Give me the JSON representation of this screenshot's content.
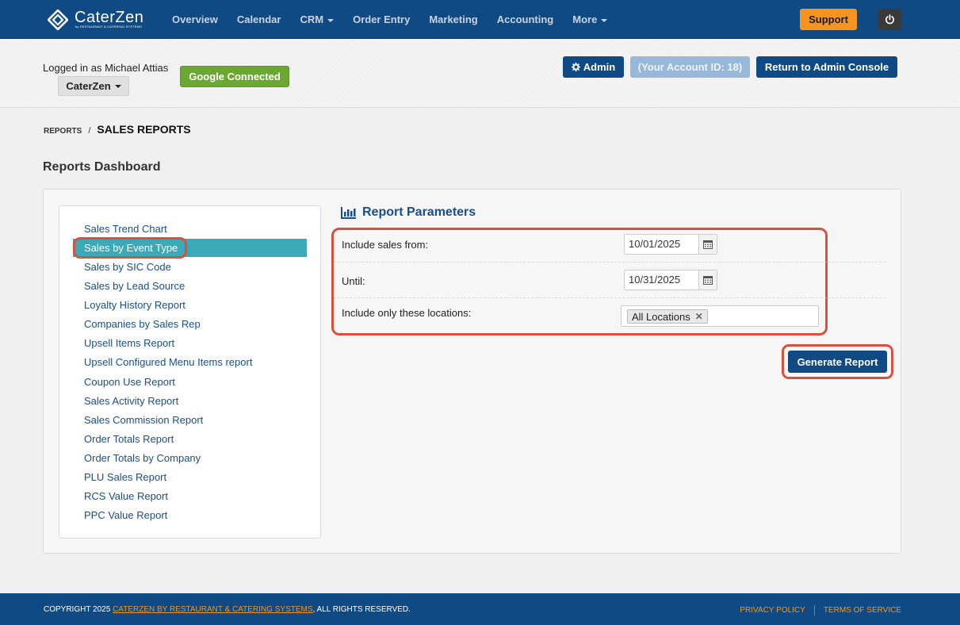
{
  "brand": {
    "name": "CaterZen",
    "tagline": "by RESTAURANT & CATERING SYSTEMS"
  },
  "nav": {
    "items": [
      {
        "label": "Overview",
        "dropdown": false
      },
      {
        "label": "Calendar",
        "dropdown": false
      },
      {
        "label": "CRM",
        "dropdown": true
      },
      {
        "label": "Order Entry",
        "dropdown": false
      },
      {
        "label": "Marketing",
        "dropdown": false
      },
      {
        "label": "Accounting",
        "dropdown": false
      },
      {
        "label": "More",
        "dropdown": true
      }
    ],
    "support_label": "Support",
    "power_icon": "power-icon"
  },
  "account": {
    "logged_in_text": "Logged in as Michael Attias",
    "org_label": "CaterZen",
    "google_label": "Google Connected",
    "admin_label": "Admin",
    "account_id_label": "(Your Account ID: 18)",
    "return_label": "Return to Admin Console"
  },
  "breadcrumb": {
    "parent": "REPORTS",
    "separator": "/",
    "current": "SALES REPORTS"
  },
  "page_title": "Reports Dashboard",
  "reports": [
    "Sales Trend Chart",
    "Sales by Event Type",
    "Sales by SIC Code",
    "Sales by Lead Source",
    "Loyalty History Report",
    "Companies by Sales Rep",
    "Upsell Items Report",
    "Upsell Configured Menu Items report",
    "Coupon Use Report",
    "Sales Activity Report",
    "Sales Commission Report",
    "Order Totals Report",
    "Order Totals by Company",
    "PLU Sales Report",
    "RCS Value Report",
    "PPC Value Report"
  ],
  "active_report_index": 1,
  "params": {
    "title": "Report Parameters",
    "from_label": "Include sales from:",
    "from_value": "10/01/2025",
    "until_label": "Until:",
    "until_value": "10/31/2025",
    "locations_label": "Include only these locations:",
    "location_tag": "All Locations",
    "generate_label": "Generate Report"
  },
  "footer": {
    "copyright_prefix": "COPYRIGHT 2025 ",
    "company_link": "CATERZEN BY RESTAURANT & CATERING SYSTEMS",
    "copyright_suffix": ", ALL RIGHTS RESERVED.",
    "privacy": "PRIVACY POLICY",
    "terms": "TERMS OF SERVICE"
  },
  "colors": {
    "primary": "#0f4a84",
    "support": "#f7941d",
    "google": "#6aa832",
    "active_item": "#3aaab8",
    "highlight": "#d9503f",
    "link": "#1a4e8a"
  }
}
